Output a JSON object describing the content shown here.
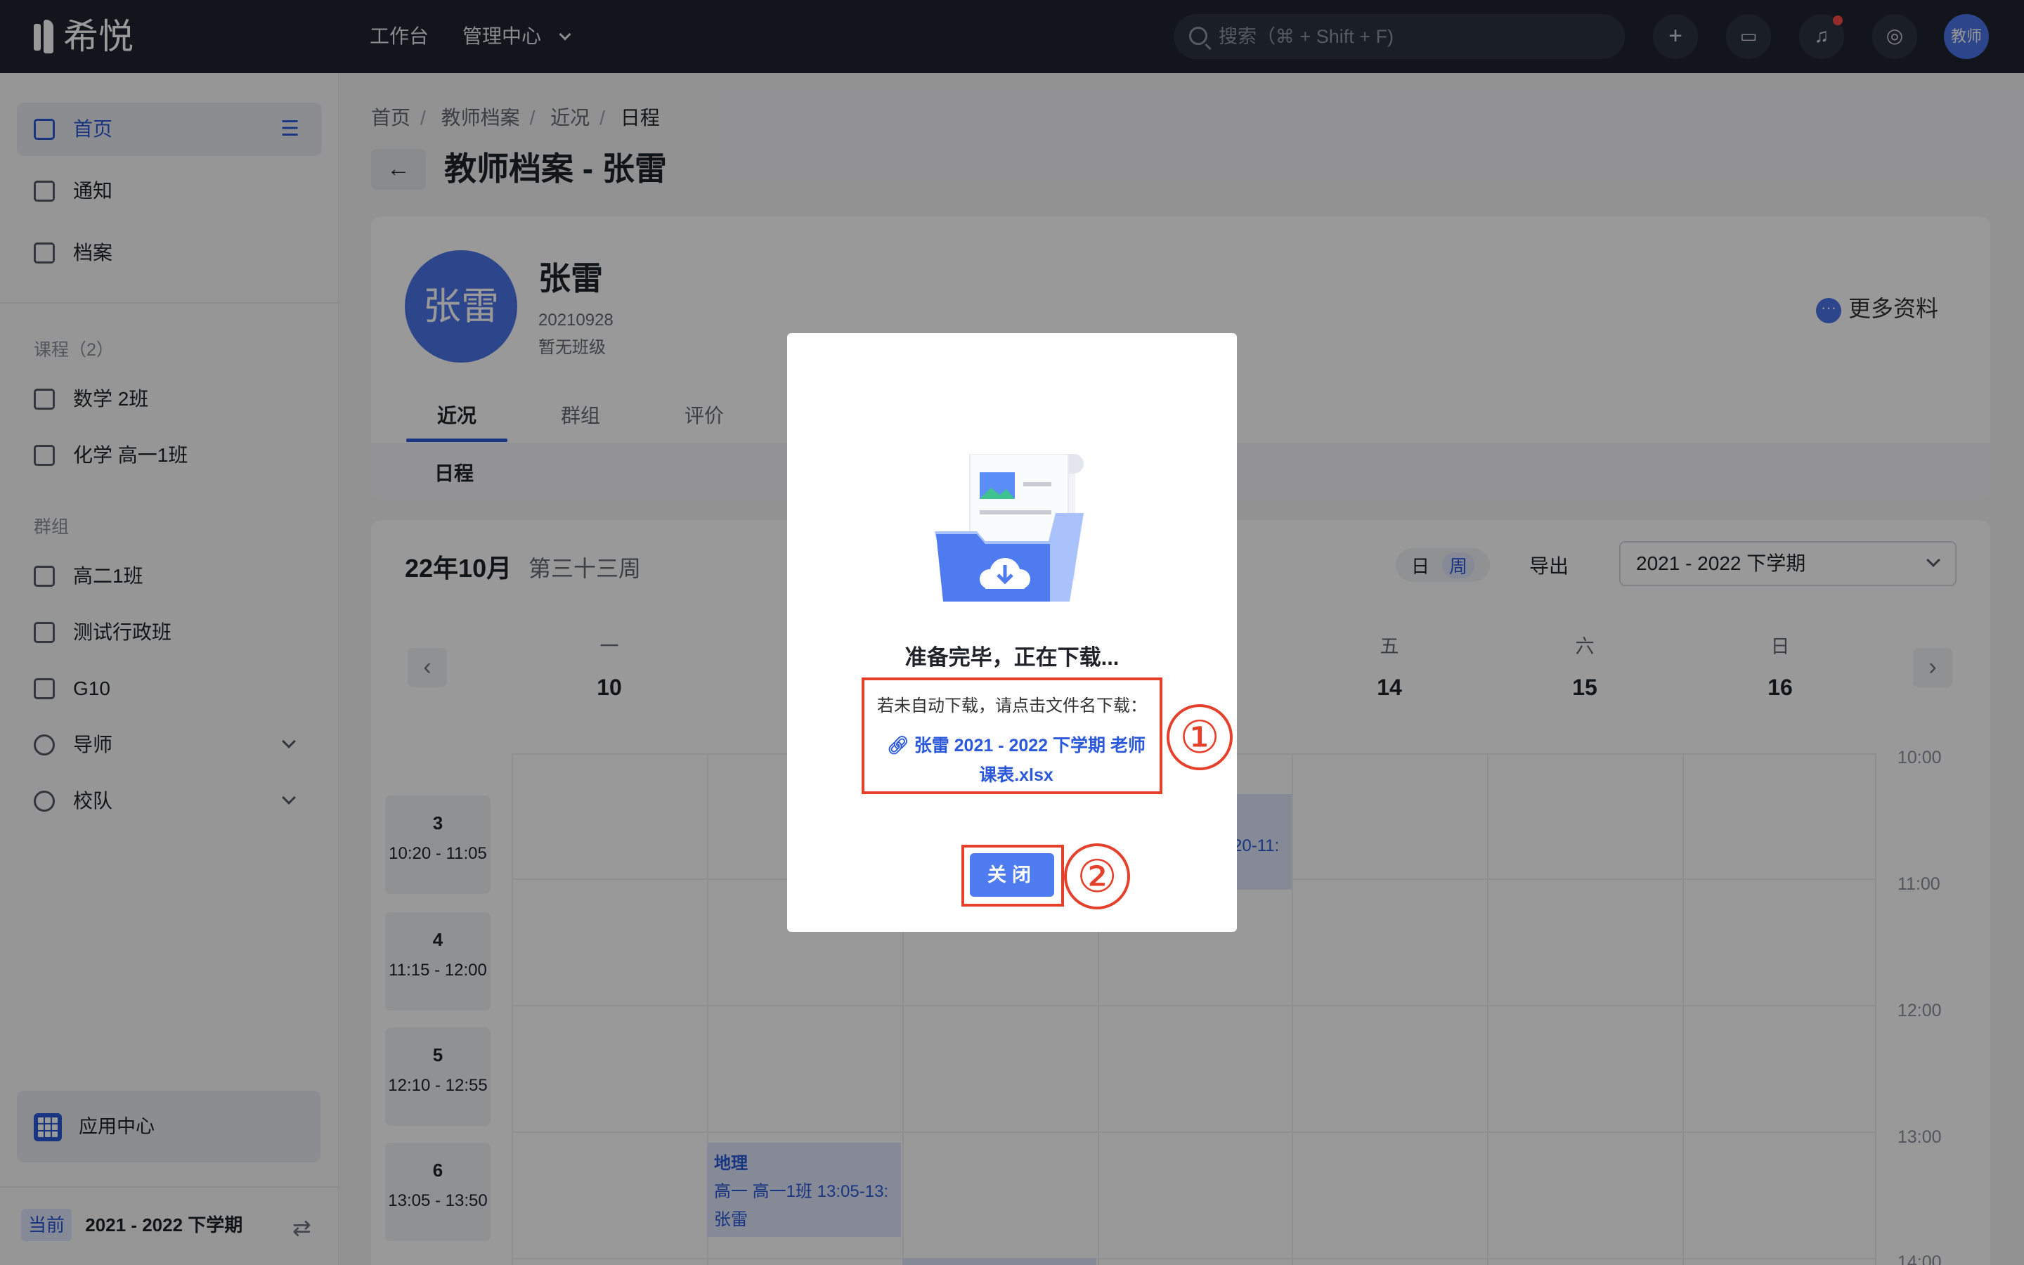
{
  "topbar": {
    "logo": "希悦",
    "nav": [
      "工作台",
      "管理中心"
    ],
    "search_placeholder": "搜索（⌘ + Shift + F)",
    "avatar": "教师"
  },
  "sidebar": {
    "main_items": [
      "首页",
      "通知",
      "档案"
    ],
    "courses_header": "课程（2）",
    "courses": [
      "数学 2班",
      "化学 高一1班"
    ],
    "groups_header": "群组",
    "groups": [
      "高二1班",
      "测试行政班",
      "G10",
      "导师",
      "校队"
    ],
    "app_center": "应用中心",
    "term_tag": "当前",
    "term": "2021 - 2022 下学期"
  },
  "breadcrumb": [
    "首页",
    "教师档案",
    "近况",
    "日程"
  ],
  "page_title": "教师档案 - 张雷",
  "profile": {
    "avatar_text": "张雷",
    "name": "张雷",
    "id": "20210928",
    "class": "暂无班级",
    "more": "更多资料",
    "tabs": [
      "近况",
      "群组",
      "评价"
    ],
    "subtab": "日程"
  },
  "calendar": {
    "month": "22年10月",
    "week": "第三十三周",
    "views": [
      "日",
      "周"
    ],
    "export": "导出",
    "term_select": "2021 - 2022 下学期",
    "days": [
      {
        "name": "一",
        "num": "10"
      },
      {
        "name": "五",
        "num": "14"
      },
      {
        "name": "六",
        "num": "15"
      },
      {
        "name": "日",
        "num": "16"
      }
    ],
    "periods": [
      {
        "num": "3",
        "time": "10:20 - 11:05"
      },
      {
        "num": "4",
        "time": "11:15 - 12:00"
      },
      {
        "num": "5",
        "time": "12:10 - 12:55"
      },
      {
        "num": "6",
        "time": "13:05 - 13:50"
      }
    ],
    "hours": [
      "10:00",
      "11:00",
      "12:00",
      "13:00",
      "14:00"
    ],
    "event_geo": {
      "title": "地理",
      "line1": "高一  高一1班  13:05-13:",
      "line2": "张雷"
    },
    "event_partial": "20-11:"
  },
  "modal": {
    "title": "准备完毕，正在下载...",
    "hint": "若未自动下载，请点击文件名下载：",
    "file_line1": "张雷 2021 - 2022 下学期 老师",
    "file_line2": "课表.xlsx",
    "close": "关闭",
    "badge1": "①",
    "badge2": "②"
  },
  "colors": {
    "accent": "#2b59d9",
    "topbar": "#1f2430",
    "annotation": "#e5402b"
  }
}
